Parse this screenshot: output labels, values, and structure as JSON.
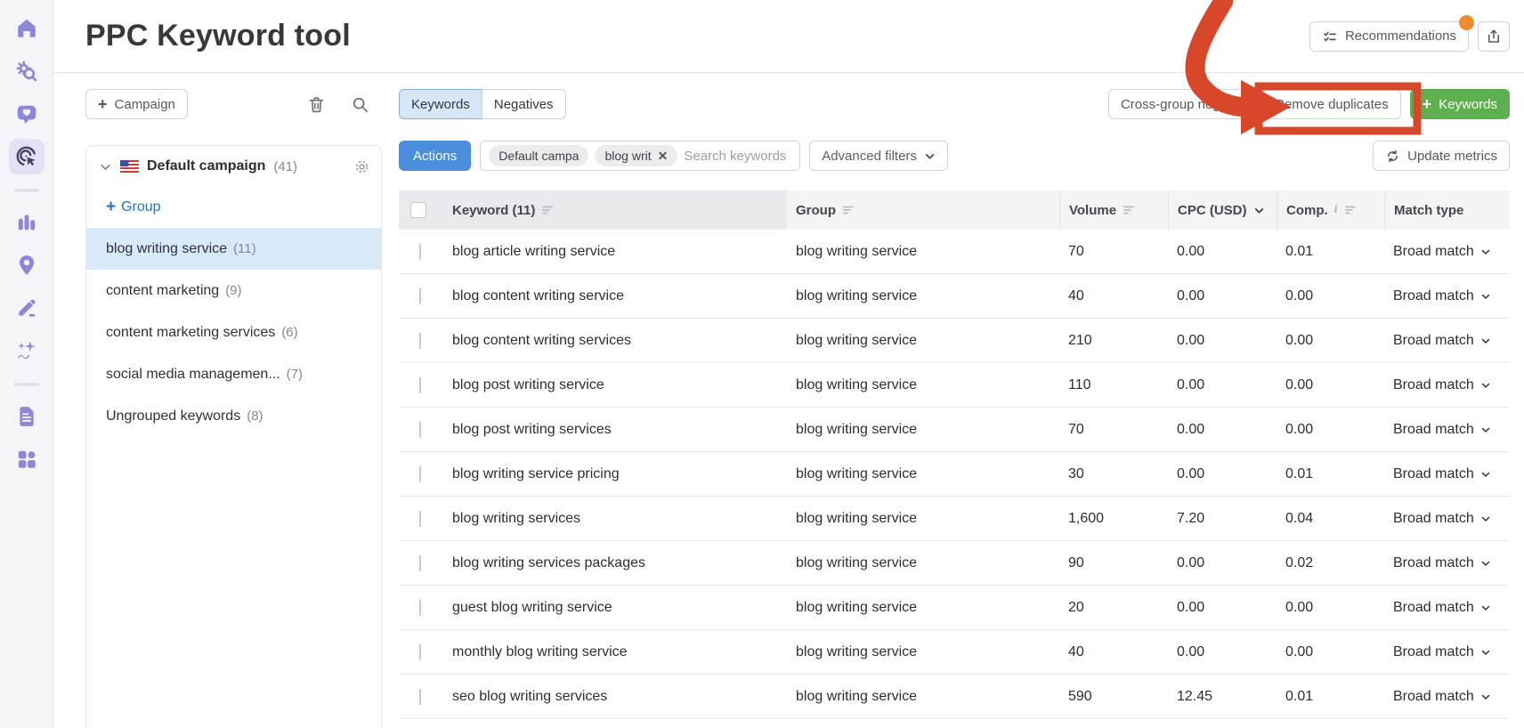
{
  "app_title": "PPC Keyword tool",
  "header": {
    "recommendations_label": "Recommendations",
    "has_notification_dot": true
  },
  "sidebar_icons": [
    "home",
    "keyword-research",
    "feedback",
    "ppc-keyword-tool",
    "analytics",
    "locations",
    "content-editor",
    "ai-insights",
    "reports",
    "apps"
  ],
  "left_panel": {
    "campaign_button_label": "Campaign",
    "campaign": {
      "name": "Default campaign",
      "count": "(41)",
      "flag": "us"
    },
    "add_group_label": "Group",
    "groups": [
      {
        "name": "blog writing service",
        "count": "(11)",
        "selected": true
      },
      {
        "name": "content marketing",
        "count": "(9)",
        "selected": false
      },
      {
        "name": "content marketing services",
        "count": "(6)",
        "selected": false
      },
      {
        "name": "social media managemen...",
        "count": "(7)",
        "selected": false
      },
      {
        "name": "Ungrouped keywords",
        "count": "(8)",
        "selected": false
      }
    ]
  },
  "toolbar": {
    "tabs": [
      {
        "label": "Keywords",
        "active": true
      },
      {
        "label": "Negatives",
        "active": false
      }
    ],
    "cross_group_negatives_label": "Cross-group negativ",
    "remove_duplicates_label": "Remove duplicates",
    "add_keywords_label": "Keywords",
    "actions_label": "Actions",
    "filter_chips": [
      {
        "label": "Default campa",
        "removable": false
      },
      {
        "label": "blog writ",
        "removable": true
      }
    ],
    "search_placeholder": "Search keywords",
    "advanced_filters_label": "Advanced filters",
    "update_metrics_label": "Update metrics"
  },
  "table": {
    "columns": {
      "keyword": "Keyword (11)",
      "group": "Group",
      "volume": "Volume",
      "cpc": "CPC (USD)",
      "comp": "Comp.",
      "match_type": "Match type"
    },
    "rows": [
      {
        "keyword": "blog article writing service",
        "group": "blog writing service",
        "volume": "70",
        "cpc": "0.00",
        "comp": "0.01",
        "match": "Broad match"
      },
      {
        "keyword": "blog content writing service",
        "group": "blog writing service",
        "volume": "40",
        "cpc": "0.00",
        "comp": "0.00",
        "match": "Broad match"
      },
      {
        "keyword": "blog content writing services",
        "group": "blog writing service",
        "volume": "210",
        "cpc": "0.00",
        "comp": "0.00",
        "match": "Broad match"
      },
      {
        "keyword": "blog post writing service",
        "group": "blog writing service",
        "volume": "110",
        "cpc": "0.00",
        "comp": "0.00",
        "match": "Broad match"
      },
      {
        "keyword": "blog post writing services",
        "group": "blog writing service",
        "volume": "70",
        "cpc": "0.00",
        "comp": "0.00",
        "match": "Broad match"
      },
      {
        "keyword": "blog writing service pricing",
        "group": "blog writing service",
        "volume": "30",
        "cpc": "0.00",
        "comp": "0.01",
        "match": "Broad match"
      },
      {
        "keyword": "blog writing services",
        "group": "blog writing service",
        "volume": "1,600",
        "cpc": "7.20",
        "comp": "0.04",
        "match": "Broad match"
      },
      {
        "keyword": "blog writing services packages",
        "group": "blog writing service",
        "volume": "90",
        "cpc": "0.00",
        "comp": "0.02",
        "match": "Broad match"
      },
      {
        "keyword": "guest blog writing service",
        "group": "blog writing service",
        "volume": "20",
        "cpc": "0.00",
        "comp": "0.00",
        "match": "Broad match"
      },
      {
        "keyword": "monthly blog writing service",
        "group": "blog writing service",
        "volume": "40",
        "cpc": "0.00",
        "comp": "0.00",
        "match": "Broad match"
      },
      {
        "keyword": "seo blog writing services",
        "group": "blog writing service",
        "volume": "590",
        "cpc": "12.45",
        "comp": "0.01",
        "match": "Broad match"
      }
    ]
  },
  "colors": {
    "accent_blue": "#4a8edc",
    "green": "#5cb14e",
    "annotation_red": "#d9472b",
    "notification_orange": "#ef8b2c",
    "selected_row_blue": "#d8e9f9",
    "active_tab_blue": "#d7e7f8",
    "sidebar_icon_purple": "#8d86d9",
    "link_blue": "#2273c9"
  }
}
